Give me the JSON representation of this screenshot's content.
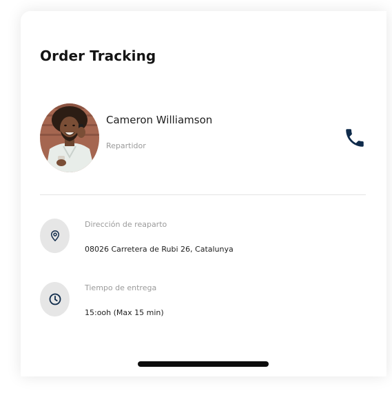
{
  "title": "Order Tracking",
  "courier": {
    "name": "Cameron Williamson",
    "role": "Repartidor",
    "call_icon": "phone-icon"
  },
  "address": {
    "icon": "location-pin-icon",
    "label": "Dirección de reaparto",
    "value": "08026 Carretera de Rubi 26, Catalunya"
  },
  "delivery_time": {
    "icon": "clock-icon",
    "label": "Tiempo de entrega",
    "value": "15:ooh (Max 15 min)"
  },
  "colors": {
    "accent": "#0f2b4b",
    "icon_bg": "#e6e6e6",
    "muted_text": "#9a9a9a"
  }
}
